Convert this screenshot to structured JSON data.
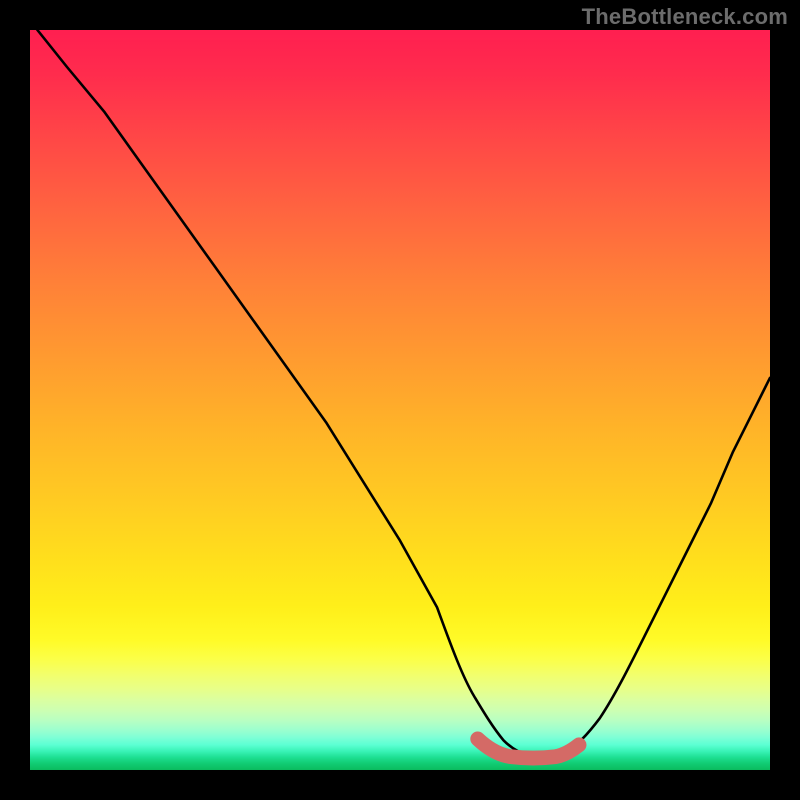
{
  "watermark": {
    "text": "TheBottleneck.com"
  },
  "chart_data": {
    "type": "line",
    "title": "",
    "xlabel": "",
    "ylabel": "",
    "xlim": [
      0,
      100
    ],
    "ylim": [
      0,
      100
    ],
    "grid": false,
    "legend": false,
    "series": [
      {
        "name": "bottleneck-curve",
        "color": "#000000",
        "x": [
          1,
          5,
          10,
          15,
          20,
          25,
          30,
          35,
          40,
          45,
          50,
          55,
          58,
          60,
          62,
          65,
          68,
          71,
          74,
          77,
          80,
          83,
          86,
          89,
          92,
          95,
          98,
          100
        ],
        "y": [
          100,
          95,
          89,
          82,
          75,
          68,
          61,
          54,
          47,
          39,
          31,
          22,
          15,
          10,
          6,
          3,
          2,
          2,
          3,
          6,
          12,
          18,
          24,
          30,
          36,
          43,
          49,
          53
        ]
      },
      {
        "name": "valley-marker",
        "color": "#d46a66",
        "x": [
          60,
          62,
          64,
          66,
          68,
          70,
          72,
          74
        ],
        "y": [
          4.0,
          2.5,
          2.0,
          1.8,
          1.8,
          1.9,
          2.2,
          3.0
        ]
      }
    ],
    "background_gradient": {
      "top": "#ff1f50",
      "mid": "#ffe01c",
      "bottom": "#0bbb5e"
    }
  }
}
